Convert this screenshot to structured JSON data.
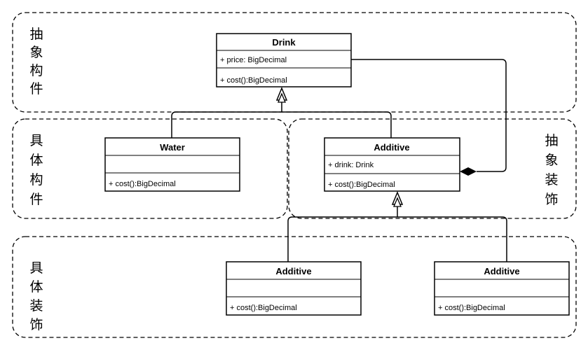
{
  "regions": {
    "abstract_component": [
      "抽",
      "象",
      "构",
      "件"
    ],
    "concrete_component": [
      "具",
      "体",
      "构",
      "件"
    ],
    "abstract_decorator": [
      "抽",
      "象",
      "装",
      "饰"
    ],
    "concrete_decorator": [
      "具",
      "体",
      "装",
      "饰"
    ]
  },
  "classes": {
    "drink": {
      "name": "Drink",
      "attribute": "+ price: BigDecimal",
      "method": "+ cost():BigDecimal"
    },
    "water": {
      "name": "Water",
      "attribute": "",
      "method": "+ cost():BigDecimal"
    },
    "additive": {
      "name": "Additive",
      "attribute": "+ drink: Drink",
      "method": "+ cost():BigDecimal"
    },
    "additive_left": {
      "name": "Additive",
      "attribute": "",
      "method": "+ cost():BigDecimal"
    },
    "additive_right": {
      "name": "Additive",
      "attribute": "",
      "method": "+ cost():BigDecimal"
    }
  },
  "relations": [
    "Water inherits Drink",
    "Additive inherits Drink",
    "Additive composes Drink",
    "Additive (left) inherits Additive",
    "Additive (right) inherits Additive"
  ]
}
